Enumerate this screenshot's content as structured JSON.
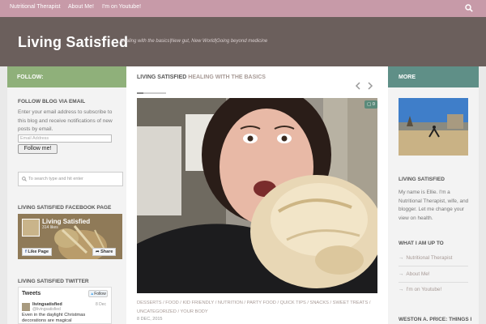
{
  "nav": {
    "items": [
      "Nutritional Therapist",
      "About Me!",
      "I'm on Youtube!"
    ],
    "search_icon": "search-icon"
  },
  "header": {
    "title": "Living Satisfied",
    "tagline": "Healing with the basics|New gut, New World|Going beyond medicine"
  },
  "left_sidebar": {
    "heading": "FOLLOW:",
    "follow_title": "FOLLOW BLOG VIA EMAIL",
    "follow_desc": "Enter your email address to subscribe to this blog and receive notifications of new posts by email.",
    "email_placeholder": "Email Address",
    "follow_button": "Follow me!",
    "search_placeholder": "To search type and hit enter",
    "fb_title": "LIVING SATISFIED FACEBOOK PAGE",
    "fb_name": "Living Satisfied",
    "fb_likes": "314 likes",
    "fb_like_button": "Like Page",
    "fb_share_button": "Share",
    "twitter_title": "LIVING SATISFIED TWITTER",
    "tw_head": "Tweets",
    "tw_follow": "Follow",
    "tw_user": "livingsatisfied",
    "tw_handle": "@livingsatisfied",
    "tw_date": "8 Dec",
    "tw_text": "Even in the daylight Christmas decorations are magical"
  },
  "main": {
    "heading_strong": "LIVING SATISFIED",
    "heading_accent": "HEALING WITH THE BASICS",
    "comment_count": "0",
    "post_tags": "DESSERTS / FOOD / KID FRIENDLY / NUTRITION / PARTY FOOD / QUICK TIPS / SNACKS / SWEET TREATS / UNCATEGORIZED / YOUR BODY",
    "post_date": "8 DEC, 2015"
  },
  "right_sidebar": {
    "heading": "MORE",
    "about_title": "LIVING SATISFIED",
    "about_desc": "My name is Ellie. I'm a Nutritional Therapist, wife, and blogger. Let me change your view on health.",
    "up_to_title": "WHAT I AM UP TO",
    "links": [
      "Nutritional Therapist",
      "About Me!",
      "I'm on Youtube!"
    ],
    "bottom_title": "WESTON A. PRICE: THINGS I"
  },
  "colors": {
    "nav_bg": "#c79aa8",
    "header_bg": "#6b5f5c",
    "follow_head": "#8fb07a",
    "more_head": "#5f8f87",
    "link_color": "#a79a96"
  }
}
